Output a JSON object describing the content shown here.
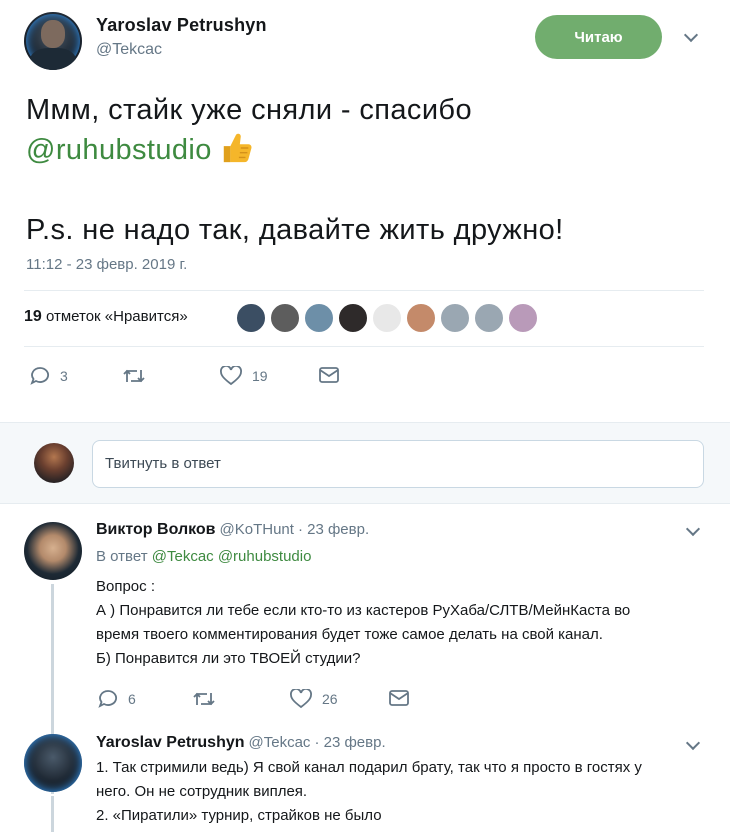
{
  "tweet": {
    "author_name": "Yaroslav Petrushyn",
    "author_handle": "@Tekcac",
    "follow_label": "Читаю",
    "text_line1": "Ммм, стайк уже сняли - спасибо",
    "text_mention": "@ruhubstudio",
    "text_line3": "P.s. не надо так, давайте жить дружно!",
    "timestamp": "11:12 - 23 февр. 2019 г.",
    "likes_count": "19",
    "likes_label": "отметок «Нравится»",
    "actions": {
      "reply_count": "3",
      "retweet_count": "",
      "like_count": "19"
    }
  },
  "compose": {
    "placeholder": "Твитнуть в ответ"
  },
  "replies": [
    {
      "author_name": "Виктор Волков",
      "author_handle": "@KoTHunt",
      "date": "· 23 февр.",
      "reply_prefix": "В ответ",
      "reply_mentions": "@Tekcac @ruhubstudio",
      "lines": [
        "Вопрос :",
        "А ) Понравится ли тебе  если кто-то из кастеров РуХаба/СЛТВ/МейнКаста во",
        "время твоего комментирования будет тоже самое делать на свой канал.",
        "Б) Понравится ли это ТВОЕЙ студии?"
      ],
      "reply_count": "6",
      "like_count": "26"
    },
    {
      "author_name": "Yaroslav Petrushyn",
      "author_handle": "@Tekcac",
      "date": "· 23 февр.",
      "lines": [
        "1. Так стримили ведь) Я свой канал подарил брату, так что я просто в гостях у",
        "него. Он не сотрудник виплея.",
        "2. «Пиратили» турнир, страйков не было"
      ]
    }
  ],
  "colors": {
    "follow_green": "#71ad6e",
    "mention_green": "#3e8a40",
    "secondary_text": "#657786"
  }
}
